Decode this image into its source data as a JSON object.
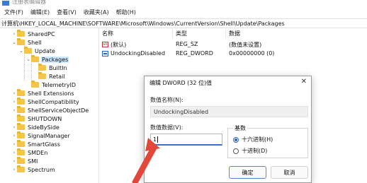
{
  "window": {
    "title": "注册表编辑器"
  },
  "menu": [
    "文件(F)",
    "编辑(E)",
    "查看(V)",
    "收藏夹(A)",
    "帮助(H)"
  ],
  "address": "计算机\\HKEY_LOCAL_MACHINE\\SOFTWARE\\Microsoft\\Windows\\CurrentVersion\\Shell\\Update\\Packages",
  "tree": [
    {
      "label": "SharedPC",
      "level": 2,
      "chevron": "›"
    },
    {
      "label": "Shell",
      "level": 2,
      "chevron": "⌄"
    },
    {
      "label": "Update",
      "level": 3,
      "chevron": "⌄"
    },
    {
      "label": "Packages",
      "level": 4,
      "chevron": "⌄",
      "selected": true
    },
    {
      "label": "BuiltIn",
      "level": 5,
      "chevron": ""
    },
    {
      "label": "Retail",
      "level": 5,
      "chevron": ""
    },
    {
      "label": "TelemetryID",
      "level": 4,
      "chevron": ""
    },
    {
      "label": "Shell Extensions",
      "level": 2,
      "chevron": "›"
    },
    {
      "label": "ShellCompatibility",
      "level": 2,
      "chevron": "›"
    },
    {
      "label": "ShellServiceObjectDe",
      "level": 2,
      "chevron": "›"
    },
    {
      "label": "SHUTDOWN",
      "level": 2,
      "chevron": ""
    },
    {
      "label": "SideBySide",
      "level": 2,
      "chevron": "›"
    },
    {
      "label": "SignalManager",
      "level": 2,
      "chevron": "›"
    },
    {
      "label": "SmartGlass",
      "level": 2,
      "chevron": "›"
    },
    {
      "label": "SMDEn",
      "level": 2,
      "chevron": "›"
    },
    {
      "label": "SMI",
      "level": 2,
      "chevron": "›"
    },
    {
      "label": "Spectrum",
      "level": 2,
      "chevron": "›"
    }
  ],
  "list": {
    "headers": {
      "name": "名称",
      "type": "类型",
      "data": "数据"
    },
    "rows": [
      {
        "icon": "string-value-icon",
        "name": "(默认)",
        "type": "REG_SZ",
        "data": "(数值未设置)"
      },
      {
        "icon": "dword-value-icon",
        "name": "UndockingDisabled",
        "type": "REG_DWORD",
        "data": "0x00000000 (0)"
      }
    ]
  },
  "dialog": {
    "title": "编辑 DWORD (32 位)值",
    "close": "✕",
    "name_label": "数值名称(N):",
    "name_value": "UndockingDisabled",
    "data_label": "数值数据(V):",
    "data_value": "1",
    "base_label": "基数",
    "base_options": [
      {
        "label": "十六进制(H)",
        "checked": true
      },
      {
        "label": "十进制(D)",
        "checked": false
      }
    ],
    "ok": "确定",
    "cancel": "取消"
  },
  "colors": {
    "accent": "#2f62c9",
    "annotation_arrow": "#e2473a",
    "folder": "#f3c54a"
  }
}
